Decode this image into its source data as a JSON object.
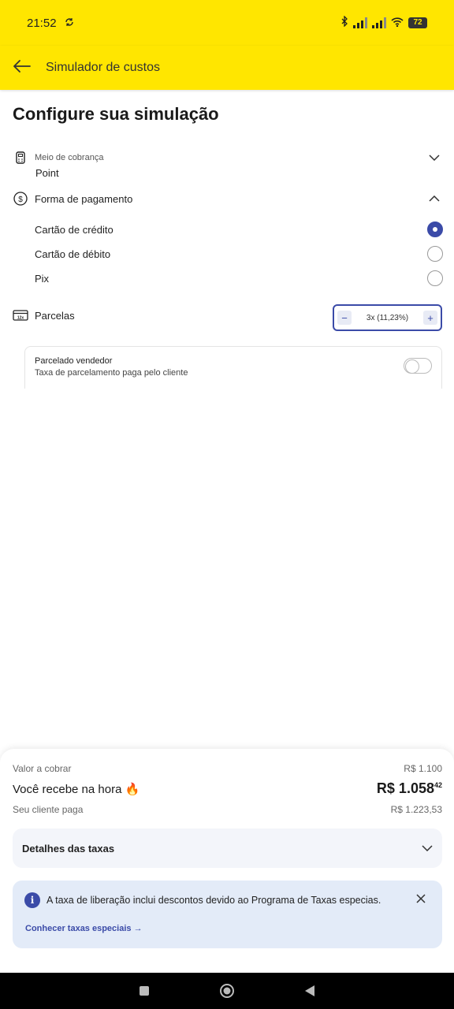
{
  "status_bar": {
    "time": "21:52",
    "battery": "72",
    "icons": [
      "sync-icon",
      "bluetooth-icon",
      "signal-icon",
      "signal-icon",
      "wifi-icon",
      "battery-icon"
    ]
  },
  "app_bar": {
    "title": "Simulador de custos",
    "back_icon": "arrow-left-icon"
  },
  "page": {
    "title": "Configure sua simulação"
  },
  "meio": {
    "label": "Meio de cobrança",
    "value": "Point"
  },
  "forma": {
    "label": "Forma de pagamento",
    "options": [
      {
        "label": "Cartão de crédito",
        "selected": true
      },
      {
        "label": "Cartão de débito",
        "selected": false
      },
      {
        "label": "Pix",
        "selected": false
      }
    ]
  },
  "parcelas": {
    "label": "Parcelas",
    "value": "3x (11,23%)",
    "minus": "−",
    "plus": "+"
  },
  "parcelado": {
    "title": "Parcelado vendedor",
    "subtitle": "Taxa de parcelamento paga pelo cliente",
    "enabled": false
  },
  "summary": {
    "valor_label": "Valor a cobrar",
    "valor_value": "R$ 1.100",
    "recebe_label": "Você recebe na hora 🔥",
    "recebe_value": "R$ 1.058",
    "recebe_cents": "42",
    "cliente_label": "Seu cliente paga",
    "cliente_value": "R$ 1.223,53"
  },
  "details": {
    "label": "Detalhes das taxas"
  },
  "info": {
    "icon": "i",
    "text": "A taxa de liberação inclui descontos devido ao Programa de Taxas especias.",
    "link": "Conhecer taxas especiais →"
  },
  "colors": {
    "brand_yellow": "#FFE600",
    "accent_blue": "#3B4BA8"
  }
}
